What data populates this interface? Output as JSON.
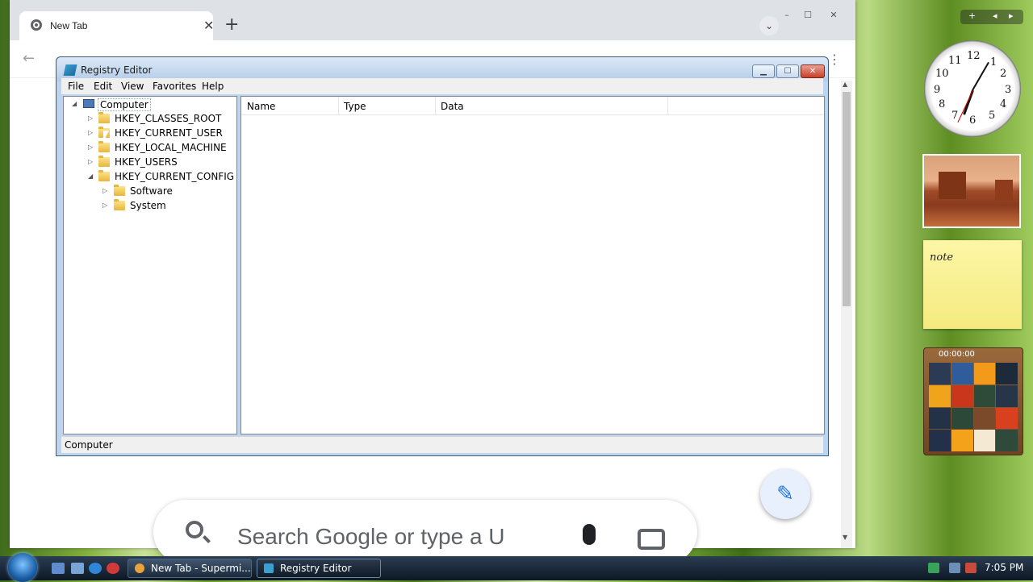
{
  "browser": {
    "tab_title": "New Tab",
    "tab_close": "✕",
    "new_tab": "+",
    "back": "←",
    "menu": "⋮",
    "search_placeholder": "Search Google or type a U",
    "edit_icon": "✎",
    "win_min": "–",
    "win_max": "☐",
    "win_close": "✕",
    "tab_search": "⌄"
  },
  "regedit": {
    "title": "Registry Editor",
    "menu": [
      "File",
      "Edit",
      "View",
      "Favorites",
      "Help"
    ],
    "columns": [
      "Name",
      "Type",
      "Data"
    ],
    "status": "Computer",
    "tree": {
      "root": "Computer",
      "hives": [
        "HKEY_CLASSES_ROOT",
        "HKEY_CURRENT_USER",
        "HKEY_LOCAL_MACHINE",
        "HKEY_USERS",
        "HKEY_CURRENT_CONFIG"
      ],
      "config_children": [
        "Software",
        "System"
      ]
    }
  },
  "gadgets": {
    "clock_numbers": [
      "12",
      "1",
      "2",
      "3",
      "4",
      "5",
      "6",
      "7",
      "8",
      "9",
      "10",
      "11"
    ],
    "note_text": "note",
    "puzzle_timer": "00:00:00",
    "bar_buttons": [
      "+",
      "◂",
      "▸"
    ]
  },
  "taskbar": {
    "items": [
      "New Tab - Supermi...",
      "Registry Editor"
    ],
    "time": "7:05 PM"
  },
  "colors": {
    "accent": "#1a73e8",
    "taskbar": "#0d1724",
    "regedit_frame": "#bcd4ee"
  }
}
